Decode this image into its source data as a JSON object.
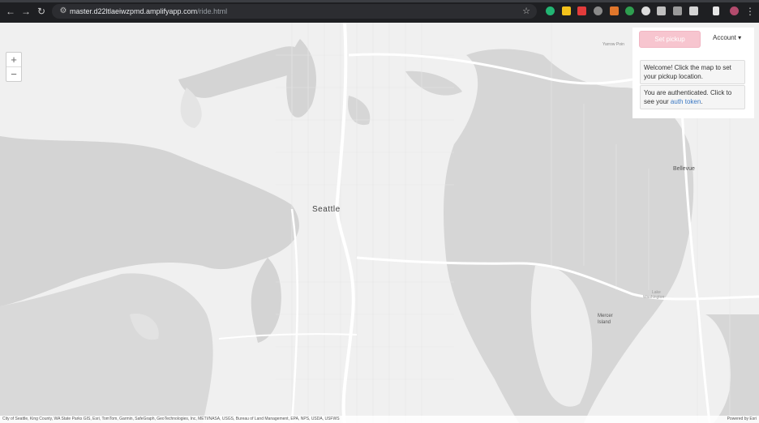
{
  "browser": {
    "url_host": "master.d22ltlaeiwzpmd.amplifyapp.com",
    "url_path": "/ride.html"
  },
  "zoom": {
    "in_label": "+",
    "out_label": "−"
  },
  "panel": {
    "set_pickup_label": "Set pickup",
    "account_label": "Account ▾",
    "welcome_text": "Welcome! Click the map to set your pickup location.",
    "auth_text": "You are authenticated. Click to see your",
    "auth_link": "auth token",
    "auth_suffix": "."
  },
  "map_labels": {
    "seattle": "Seattle",
    "bellevue": "Bellevue",
    "mercer_island_1": "Mercer",
    "mercer_island_2": "Island",
    "yarrow_point": "Yarrow Poin",
    "lake_washington_1": "Lake",
    "lake_washington_2": "Washington"
  },
  "attribution": {
    "sources": "City of Seattle, King County, WA State Parks GIS, Esri, TomTom, Garmin, SafeGraph, GeoTechnologies, Inc, METI/NASA, USGS, Bureau of Land Management, EPA, NPS, USDA, USFWS",
    "powered_by": "Powered by Esri"
  }
}
